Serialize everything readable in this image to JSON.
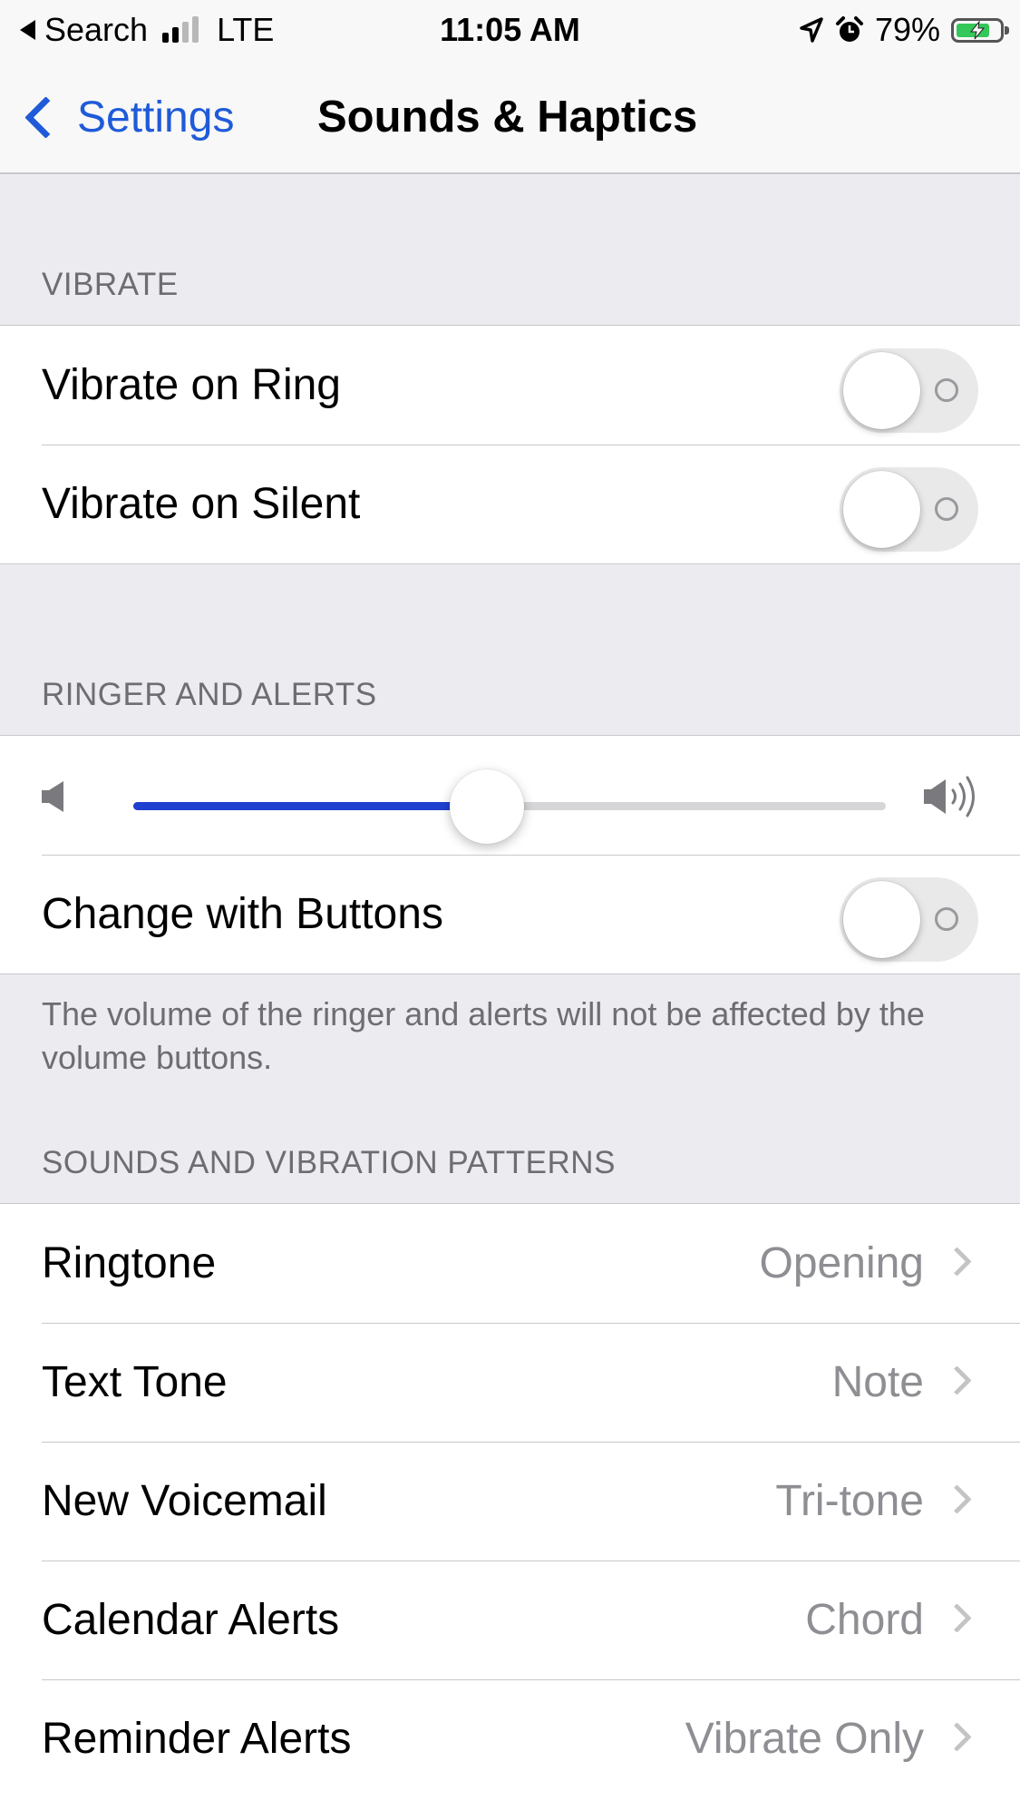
{
  "status_bar": {
    "back_app": "Search",
    "carrier": "LTE",
    "time": "11:05 AM",
    "battery": "79%",
    "battery_level": 0.79,
    "icons": [
      "back-triangle-icon",
      "signal-icon",
      "location-arrow-icon",
      "alarm-icon",
      "battery-charging-icon"
    ]
  },
  "nav": {
    "back_label": "Settings",
    "title": "Sounds & Haptics"
  },
  "vibrate": {
    "header": "VIBRATE",
    "rows": [
      {
        "label": "Vibrate on Ring",
        "on": false
      },
      {
        "label": "Vibrate on Silent",
        "on": false
      }
    ]
  },
  "ringer": {
    "header": "RINGER AND ALERTS",
    "volume_level": 0.47,
    "change_with_buttons": {
      "label": "Change with Buttons",
      "on": false
    },
    "footer": "The volume of the ringer and alerts will not be affected by the volume buttons."
  },
  "sounds": {
    "header": "SOUNDS AND VIBRATION PATTERNS",
    "rows": [
      {
        "label": "Ringtone",
        "value": "Opening"
      },
      {
        "label": "Text Tone",
        "value": "Note"
      },
      {
        "label": "New Voicemail",
        "value": "Tri-tone"
      },
      {
        "label": "Calendar Alerts",
        "value": "Chord"
      },
      {
        "label": "Reminder Alerts",
        "value": "Vibrate Only"
      }
    ]
  },
  "colors": {
    "accent": "#1f5bd8",
    "slider_fill": "#1f3fcf",
    "background": "#ebebf0",
    "secondary_text": "#8e8e93",
    "battery_fill": "#34c759"
  }
}
